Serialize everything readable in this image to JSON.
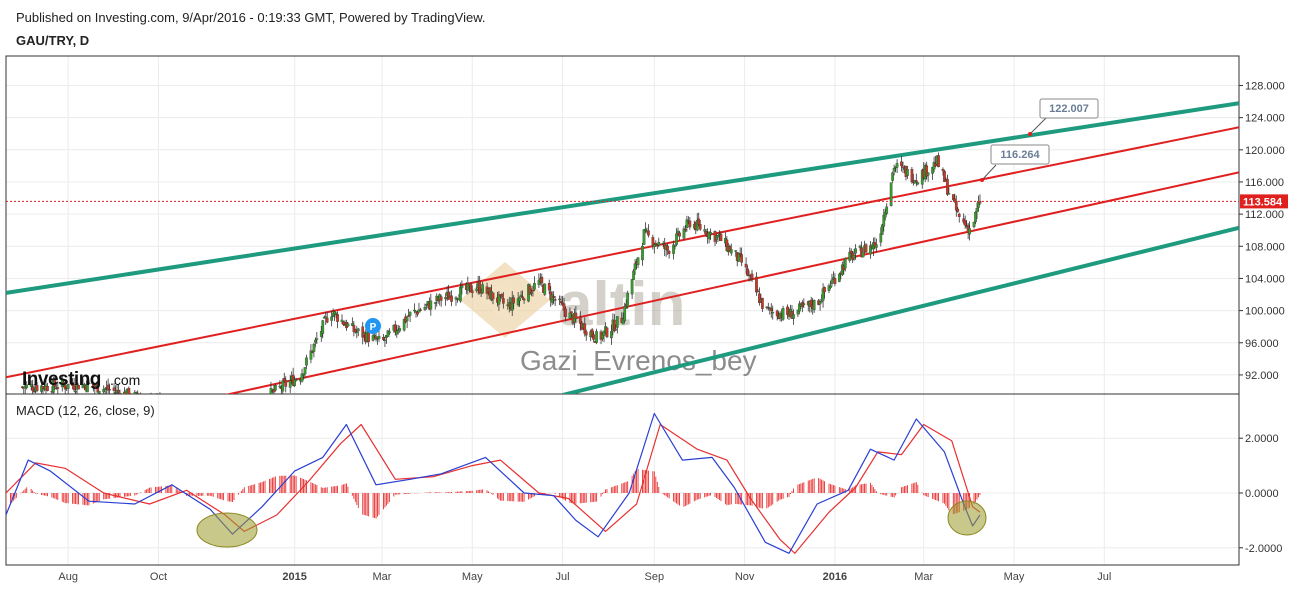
{
  "header": {
    "published": "Published on Investing.com, 9/Apr/2016 - 0:19:33 GMT, Powered by TradingView.",
    "symbol": "GAU/TRY, D"
  },
  "watermark": {
    "brand": "altin",
    "author": "Gazi_Evrenos_bey",
    "logo": "Investing",
    "logo_suffix": ".com",
    "p_marker": "P"
  },
  "colors": {
    "up": "#3a9a2e",
    "down": "#c0392b",
    "channel_outer": "#1e9a7e",
    "channel_inner": "#e02020",
    "macd_line": "#2a3fd4",
    "signal_line": "#e83030",
    "hist": "#e83030",
    "last_price_bg": "#e0201e",
    "highlight": "#9c9a2c"
  },
  "chart_data": [
    {
      "type": "candlestick",
      "title": "GAU/TRY, D",
      "x_ticks": [
        "Aug",
        "Oct",
        "2015",
        "Mar",
        "May",
        "Jul",
        "Sep",
        "Nov",
        "2016",
        "Mar",
        "May",
        "Jul"
      ],
      "y_ticks": [
        "92.000",
        "96.000",
        "100.000",
        "104.000",
        "108.000",
        "112.000",
        "116.000",
        "120.000",
        "124.000",
        "128.000"
      ],
      "ylim": [
        90.0,
        131.0
      ],
      "last_price": "113.584",
      "annotations": [
        "122.007",
        "116.264"
      ],
      "close_path": [
        [
          "2014-07-01",
          90.5
        ],
        [
          "2014-08-15",
          90.8
        ],
        [
          "2014-10-01",
          88.5
        ],
        [
          "2014-11-15",
          86.5
        ],
        [
          "2014-12-15",
          89.5
        ],
        [
          "2015-01-05",
          92.0
        ],
        [
          "2015-01-25",
          100.0
        ],
        [
          "2015-02-10",
          97.5
        ],
        [
          "2015-03-01",
          96.0
        ],
        [
          "2015-03-20",
          99.5
        ],
        [
          "2015-04-10",
          101.5
        ],
        [
          "2015-05-05",
          103.0
        ],
        [
          "2015-05-25",
          100.5
        ],
        [
          "2015-06-15",
          103.5
        ],
        [
          "2015-07-05",
          99.5
        ],
        [
          "2015-07-25",
          96.5
        ],
        [
          "2015-08-10",
          99.0
        ],
        [
          "2015-08-25",
          109.5
        ],
        [
          "2015-09-10",
          107.5
        ],
        [
          "2015-09-25",
          111.0
        ],
        [
          "2015-10-15",
          109.0
        ],
        [
          "2015-10-30",
          106.0
        ],
        [
          "2015-11-15",
          100.0
        ],
        [
          "2015-12-01",
          99.5
        ],
        [
          "2015-12-20",
          101.0
        ],
        [
          "2016-01-10",
          106.5
        ],
        [
          "2016-01-30",
          108.5
        ],
        [
          "2016-02-10",
          118.0
        ],
        [
          "2016-02-25",
          116.5
        ],
        [
          "2016-03-10",
          118.5
        ],
        [
          "2016-03-25",
          111.5
        ],
        [
          "2016-04-02",
          110.0
        ],
        [
          "2016-04-08",
          113.6
        ]
      ],
      "channel_lines": [
        {
          "name": "",
          "points": [
            [
              "2014-06-20",
              102.2
            ],
            [
              "2016-09-30",
              125.8
            ]
          ]
        },
        {
          "name": "",
          "points": [
            [
              "2014-06-20",
              91.7
            ],
            [
              "2016-09-30",
              122.8
            ]
          ]
        },
        {
          "name": "",
          "points": [
            [
              "2014-11-15",
              89.5
            ],
            [
              "2016-09-30",
              117.2
            ]
          ]
        },
        {
          "name": "",
          "points": [
            [
              "2015-07-01",
              89.5
            ],
            [
              "2016-09-30",
              110.3
            ]
          ]
        }
      ]
    },
    {
      "type": "line",
      "title": "MACD (12, 26, close, 9)",
      "y_ticks": [
        "2.0000",
        "0.0000",
        "-2.0000"
      ],
      "ylim": [
        -3.2,
        3.2
      ],
      "series": [
        {
          "name": "",
          "role": "macd",
          "points": [
            [
              "2014-06-20",
              -0.8
            ],
            [
              "2014-07-05",
              1.2
            ],
            [
              "2014-07-20",
              0.8
            ],
            [
              "2014-08-15",
              -0.3
            ],
            [
              "2014-09-15",
              -0.4
            ],
            [
              "2014-10-10",
              0.3
            ],
            [
              "2014-11-05",
              -0.6
            ],
            [
              "2014-11-20",
              -1.5
            ],
            [
              "2014-12-10",
              -0.5
            ],
            [
              "2015-01-01",
              0.8
            ],
            [
              "2015-01-20",
              1.3
            ],
            [
              "2015-02-05",
              2.5
            ],
            [
              "2015-02-25",
              0.3
            ],
            [
              "2015-03-20",
              0.5
            ],
            [
              "2015-04-10",
              0.7
            ],
            [
              "2015-05-10",
              1.3
            ],
            [
              "2015-06-05",
              0.0
            ],
            [
              "2015-06-25",
              -0.1
            ],
            [
              "2015-07-10",
              -1.0
            ],
            [
              "2015-07-25",
              -1.6
            ],
            [
              "2015-08-15",
              0.0
            ],
            [
              "2015-09-01",
              2.9
            ],
            [
              "2015-09-20",
              1.2
            ],
            [
              "2015-10-10",
              1.3
            ],
            [
              "2015-10-25",
              0.2
            ],
            [
              "2015-11-15",
              -1.8
            ],
            [
              "2015-12-01",
              -2.2
            ],
            [
              "2015-12-20",
              -0.4
            ],
            [
              "2016-01-10",
              0.1
            ],
            [
              "2016-01-25",
              1.6
            ],
            [
              "2016-02-10",
              1.2
            ],
            [
              "2016-02-25",
              2.7
            ],
            [
              "2016-03-15",
              1.5
            ],
            [
              "2016-03-28",
              -0.4
            ],
            [
              "2016-04-03",
              -1.2
            ],
            [
              "2016-04-08",
              -0.8
            ]
          ]
        },
        {
          "name": "",
          "role": "signal",
          "points": [
            [
              "2014-06-20",
              0.0
            ],
            [
              "2014-07-10",
              1.1
            ],
            [
              "2014-07-30",
              0.9
            ],
            [
              "2014-08-25",
              0.0
            ],
            [
              "2014-09-25",
              -0.4
            ],
            [
              "2014-10-20",
              0.1
            ],
            [
              "2014-11-15",
              -0.8
            ],
            [
              "2014-11-28",
              -1.4
            ],
            [
              "2014-12-20",
              -0.8
            ],
            [
              "2015-01-10",
              0.4
            ],
            [
              "2015-02-01",
              1.8
            ],
            [
              "2015-02-15",
              2.5
            ],
            [
              "2015-03-10",
              0.5
            ],
            [
              "2015-04-05",
              0.6
            ],
            [
              "2015-05-01",
              1.0
            ],
            [
              "2015-05-20",
              1.2
            ],
            [
              "2015-06-15",
              0.0
            ],
            [
              "2015-07-05",
              -0.2
            ],
            [
              "2015-07-30",
              -1.4
            ],
            [
              "2015-08-20",
              -0.4
            ],
            [
              "2015-09-05",
              2.5
            ],
            [
              "2015-09-30",
              1.6
            ],
            [
              "2015-10-20",
              1.2
            ],
            [
              "2015-11-05",
              -0.2
            ],
            [
              "2015-11-25",
              -1.7
            ],
            [
              "2015-12-05",
              -2.2
            ],
            [
              "2015-12-28",
              -0.7
            ],
            [
              "2016-01-15",
              0.2
            ],
            [
              "2016-01-30",
              1.5
            ],
            [
              "2016-02-15",
              1.4
            ],
            [
              "2016-03-01",
              2.5
            ],
            [
              "2016-03-20",
              1.9
            ],
            [
              "2016-04-03",
              -0.5
            ],
            [
              "2016-04-08",
              -0.7
            ]
          ]
        }
      ]
    }
  ]
}
